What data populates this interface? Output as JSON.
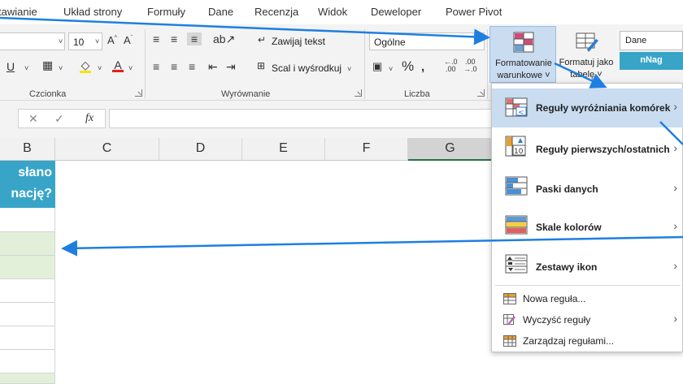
{
  "tabs": [
    "tawianie",
    "Układ strony",
    "Formuły",
    "Dane",
    "Recenzja",
    "Widok",
    "Deweloper",
    "Power Pivot"
  ],
  "font": {
    "size": "10"
  },
  "groups": {
    "font": "Czcionka",
    "alignment": "Wyrównanie",
    "number": "Liczba"
  },
  "alignment": {
    "wrap": "Zawijaj tekst",
    "merge": "Scal i wyśrodkuj"
  },
  "number": {
    "format": "Ogólne"
  },
  "conditional_formatting": {
    "line1": "Formatowanie",
    "line2": "warunkowe ˅"
  },
  "format_table": {
    "line1": "Formatuj jako",
    "line2": "tabelę ˅"
  },
  "styles": {
    "dane": "Dane",
    "nnag": "nNag"
  },
  "formula_bar": {
    "fx": "fx"
  },
  "columns": [
    "B",
    "C",
    "D",
    "E",
    "F",
    "G"
  ],
  "cell_header": {
    "line1": "słano",
    "line2": "nację?"
  },
  "menu": {
    "items": [
      {
        "label": "Reguły wyróżniania komórek",
        "icon": "highlight-cells-icon"
      },
      {
        "label": "Reguły pierwszych/ostatnich",
        "icon": "top-bottom-icon"
      },
      {
        "label": "Paski danych",
        "icon": "data-bars-icon"
      },
      {
        "label": "Skale kolorów",
        "icon": "color-scales-icon"
      },
      {
        "label": "Zestawy ikon",
        "icon": "icon-sets-icon"
      }
    ],
    "small_items": [
      {
        "label": "Nowa reguła...",
        "icon": "new-rule-icon"
      },
      {
        "label": "Wyczyść reguły",
        "icon": "clear-rules-icon"
      },
      {
        "label": "Zarządzaj regułami...",
        "icon": "manage-rules-icon"
      }
    ]
  },
  "colors": {
    "accent": "#38a5c8",
    "highlight": "#c9dcf0",
    "arrow": "#1e7fe0",
    "green_cell": "#e2f0d9"
  }
}
